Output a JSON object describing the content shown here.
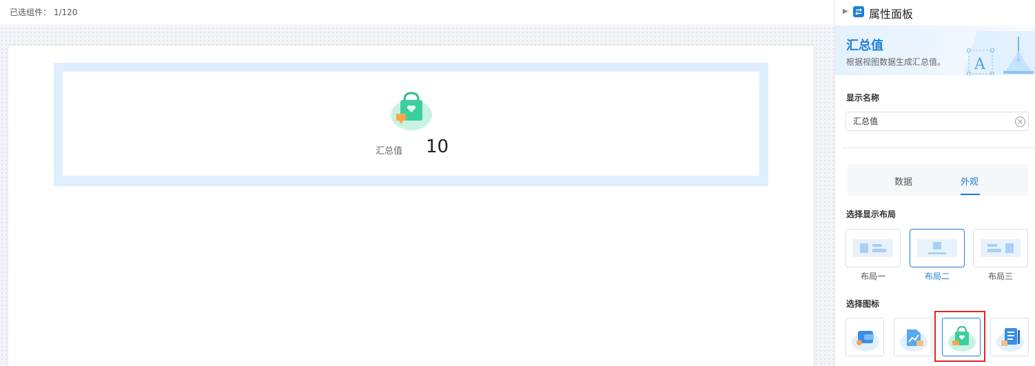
{
  "selection_bar": {
    "label": "已选组件：",
    "count": "1/120"
  },
  "widget": {
    "label": "汇总值",
    "value": "10",
    "icon": "shopping-bag-icon"
  },
  "panel": {
    "header_title": "属性面板",
    "banner": {
      "title": "汇总值",
      "description": "根据视图数据生成汇总值。"
    },
    "display_name": {
      "label": "显示名称",
      "value": "汇总值"
    },
    "tabs": [
      {
        "label": "数据",
        "active": false
      },
      {
        "label": "外观",
        "active": true
      }
    ],
    "layout": {
      "title": "选择显示布局",
      "options": [
        "布局一",
        "布局二",
        "布局三"
      ],
      "selected": "布局二"
    },
    "icons": {
      "title": "选择图标",
      "options": [
        "wallet-icon",
        "chart-card-icon",
        "shopping-bag-icon",
        "document-icon"
      ],
      "selected": "shopping-bag-icon"
    }
  },
  "colors": {
    "accent": "#1e7fd8",
    "highlight": "#e02424",
    "widget_bg": "#deeefc"
  }
}
